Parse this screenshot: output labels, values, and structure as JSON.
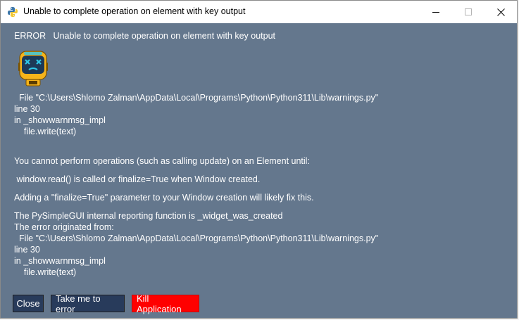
{
  "window": {
    "title": "Unable to complete operation on element with key output"
  },
  "background_fragments": [
    "s",
    "e"
  ],
  "content": {
    "heading": "ERROR   Unable to complete operation on element with key output",
    "trace1": {
      "file": "  File \"C:\\Users\\Shlomo Zalman\\AppData\\Local\\Programs\\Python\\Python311\\Lib\\warnings.py\"",
      "line": "line 30",
      "func": "in _showwarnmsg_impl",
      "code": "    file.write(text)"
    },
    "message1": "You cannot perform operations (such as calling update) on an Element until:",
    "message2": " window.read() is called or finalize=True when Window created.",
    "message3": "Adding a \"finalize=True\" parameter to your Window creation will likely fix this.",
    "reporting": "The PySimpleGUI internal reporting function is _widget_was_created",
    "originated": "The error originated from:",
    "trace2": {
      "file": "  File \"C:\\Users\\Shlomo Zalman\\AppData\\Local\\Programs\\Python\\Python311\\Lib\\warnings.py\"",
      "line": "line 30",
      "func": "in _showwarnmsg_impl",
      "code": "    file.write(text)"
    }
  },
  "buttons": {
    "close": "Close",
    "take_me": "Take me to error",
    "kill": "Kill Application"
  },
  "colors": {
    "content_bg": "#64778d",
    "button_bg": "#283b5b",
    "kill_bg": "#ff0000"
  },
  "icons": {
    "app": "python-icon",
    "emoji": "dead-robot-icon"
  }
}
